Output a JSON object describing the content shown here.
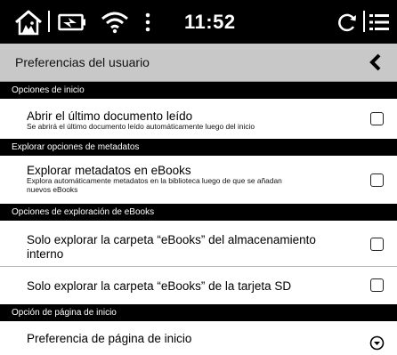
{
  "status_bar": {
    "time": "11:52",
    "icons": [
      "home-icon",
      "battery-charging-icon",
      "wifi-icon",
      "more-vertical-icon",
      "refresh-icon",
      "menu-icon"
    ]
  },
  "header": {
    "title": "Preferencias del usuario",
    "back_icon": "chevron-left-icon"
  },
  "sections": {
    "startup": "Opciones de inicio",
    "metadata": "Explorar opciones de metadatos",
    "ebook_scan": "Opciones de exploración de eBooks",
    "home_page": "Opción de página de inicio"
  },
  "items": {
    "open_last": {
      "title": "Abrir el último documento leído",
      "subtitle": "Se abrirá el último documento leído automáticamente luego del inicio",
      "checked": false
    },
    "scan_metadata": {
      "title": "Explorar metadatos en eBooks",
      "subtitle_line1": "Explora automáticamente metadatos en la biblioteca luego de que se añadan",
      "subtitle_line2": "nuevos eBooks",
      "checked": false
    },
    "internal_folder": {
      "title_line1": "Solo explorar la carpeta “eBooks” del almacenamiento",
      "title_line2": "interno",
      "checked": false
    },
    "sd_folder": {
      "title": "Solo explorar la carpeta “eBooks” de la tarjeta SD",
      "checked": false
    },
    "home_pref": {
      "title": "Preferencia de página de inicio",
      "dropdown_icon": "chevron-down-circle-icon"
    }
  }
}
